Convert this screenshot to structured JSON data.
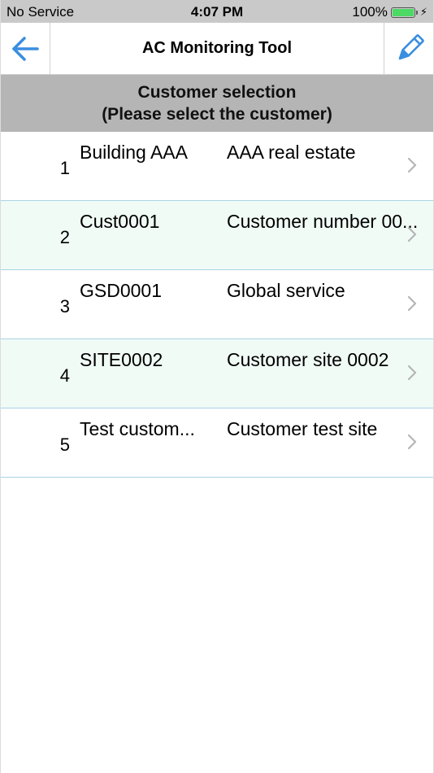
{
  "status_bar": {
    "carrier": "No Service",
    "time": "4:07 PM",
    "battery": "100%",
    "battery_level": 1.0
  },
  "nav": {
    "title": "AC Monitoring Tool",
    "back_icon": "arrow-left-icon",
    "edit_icon": "pencil-icon"
  },
  "section": {
    "line1": "Customer selection",
    "line2": "(Please select the customer)"
  },
  "customers": [
    {
      "num": "1",
      "code": "Building AAA",
      "name": "AAA real estate"
    },
    {
      "num": "2",
      "code": "Cust0001",
      "name": "Customer number 00..."
    },
    {
      "num": "3",
      "code": "GSD0001",
      "name": "Global service"
    },
    {
      "num": "4",
      "code": "SITE0002",
      "name": "Customer site 0002"
    },
    {
      "num": "5",
      "code": "Test custom...",
      "name": "Customer test site"
    }
  ],
  "colors": {
    "accent": "#3a8ee0",
    "header_bg": "#b5b5b5",
    "alt_row": "#f0fbf6",
    "divider": "#a9d3e6"
  }
}
